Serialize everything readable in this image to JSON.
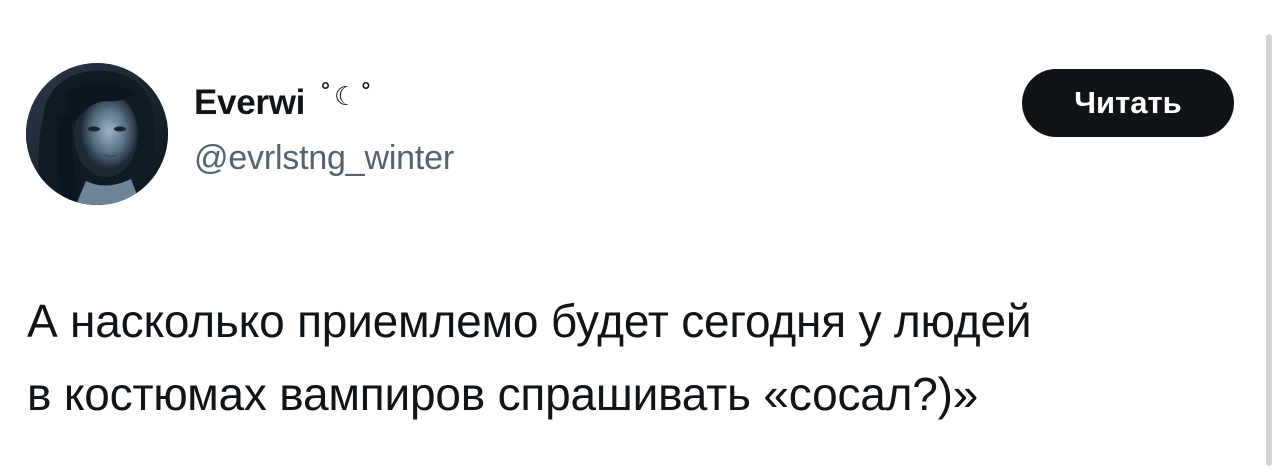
{
  "author": {
    "display_name": "Everwi",
    "name_decoration": "˚☾˚",
    "handle": "@evrlstng_winter"
  },
  "follow_button": {
    "label": "Читать"
  },
  "tweet": {
    "text_line_1": "А насколько приемлемо будет сегодня у людей",
    "text_line_2": "в костюмах вампиров спрашивать «сосал?)»"
  },
  "colors": {
    "text_primary": "#0f1419",
    "text_secondary": "#536471",
    "button_bg": "#0f1419",
    "button_text": "#ffffff",
    "background": "#ffffff"
  }
}
